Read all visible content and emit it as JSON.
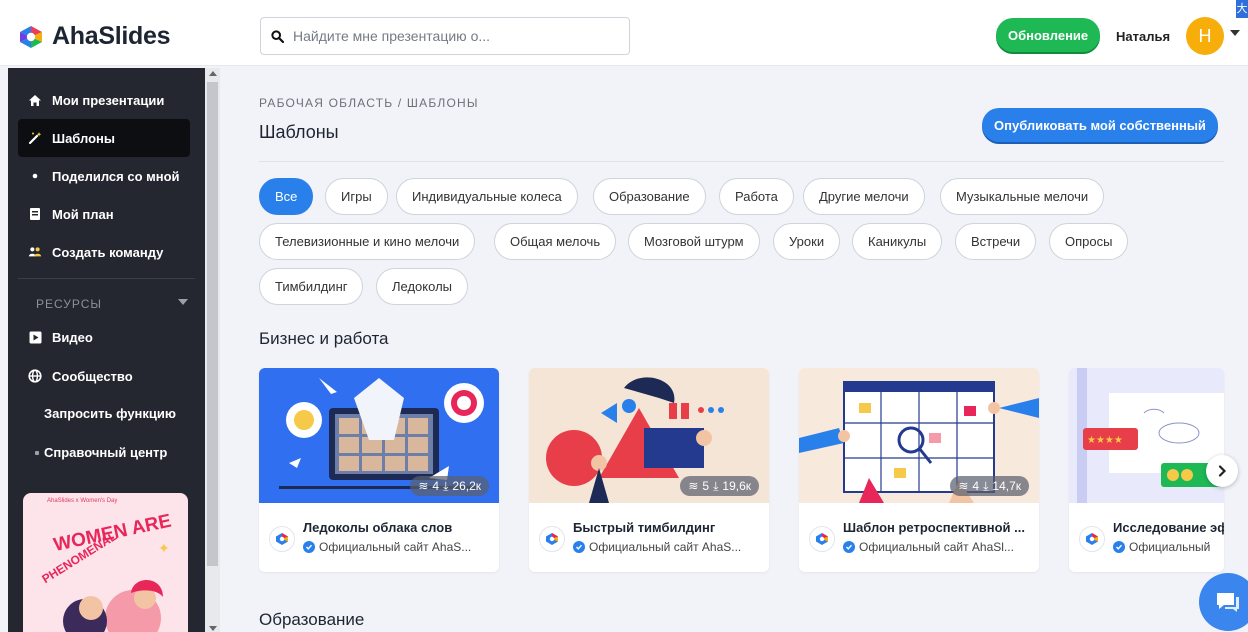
{
  "app": {
    "name": "AhaSlides",
    "colors": {
      "brand_blue": "#2a80ea",
      "upgrade_green": "#1eb955",
      "sidebar": "#24272f",
      "avatar": "#f7ad0a"
    }
  },
  "header": {
    "search_placeholder": "Найдите мне презентацию о...",
    "upgrade_label": "Обновление",
    "user_name": "Наталья",
    "avatar_initial": "H",
    "translate_badge": "大"
  },
  "sidebar": {
    "items": [
      {
        "label": "Мои презентации",
        "icon": "home-icon"
      },
      {
        "label": "Шаблоны",
        "icon": "magic-wand-icon",
        "active": true
      },
      {
        "label": "Поделился со мной",
        "icon": "share-icon"
      },
      {
        "label": "Мой план",
        "icon": "plan-icon"
      },
      {
        "label": "Создать команду",
        "icon": "team-icon"
      }
    ],
    "resources_label": "РЕСУРСЫ",
    "resources": [
      {
        "label": "Видео",
        "icon": "video-icon"
      },
      {
        "label": "Сообщество",
        "icon": "globe-icon"
      },
      {
        "label": "Запросить функцию",
        "icon": "request-icon"
      },
      {
        "label": "Справочный центр",
        "icon": "help-icon"
      }
    ],
    "promo": {
      "top": "AhaSlides x Women's Day",
      "headline_1": "WOMEN ARE",
      "headline_2": "PHENOMENAL"
    }
  },
  "main": {
    "breadcrumb": "РАБОЧАЯ ОБЛАСТЬ / ШАБЛОНЫ",
    "title": "Шаблоны",
    "publish_label": "Опубликовать мой собственный",
    "chips": [
      {
        "label": "Все",
        "active": true
      },
      {
        "label": "Игры"
      },
      {
        "label": "Индивидуальные колеса"
      },
      {
        "label": "Образование"
      },
      {
        "label": "Работа"
      },
      {
        "label": "Другие мелочи"
      },
      {
        "label": "Музыкальные мелочи"
      },
      {
        "label": "Телевизионные и кино мелочи"
      },
      {
        "label": "Общая мелочь"
      },
      {
        "label": "Мозговой штурм"
      },
      {
        "label": "Уроки"
      },
      {
        "label": "Каникулы"
      },
      {
        "label": "Встречи"
      },
      {
        "label": "Опросы"
      },
      {
        "label": "Тимбилдинг"
      },
      {
        "label": "Ледоколы"
      }
    ],
    "section_business": "Бизнес и работа",
    "section_education": "Образование",
    "cards": [
      {
        "title": "Ледоколы облака слов",
        "author": "Официальный сайт AhaS...",
        "slides": "4",
        "downloads": "26,2к",
        "thumb_color": "#2f6ff0"
      },
      {
        "title": "Быстрый тимбилдинг",
        "author": "Официальный сайт AhaS...",
        "slides": "5",
        "downloads": "19,6к",
        "thumb_color": "#f4e5d7"
      },
      {
        "title": "Шаблон ретроспективной ...",
        "author": "Официальный сайт AhaSl...",
        "slides": "4",
        "downloads": "14,7к",
        "thumb_color": "#f7e9dc"
      },
      {
        "title": "Исследование эф",
        "author": "Официальный",
        "slides": "",
        "downloads": "",
        "thumb_color": "#e8e9fb"
      }
    ]
  }
}
